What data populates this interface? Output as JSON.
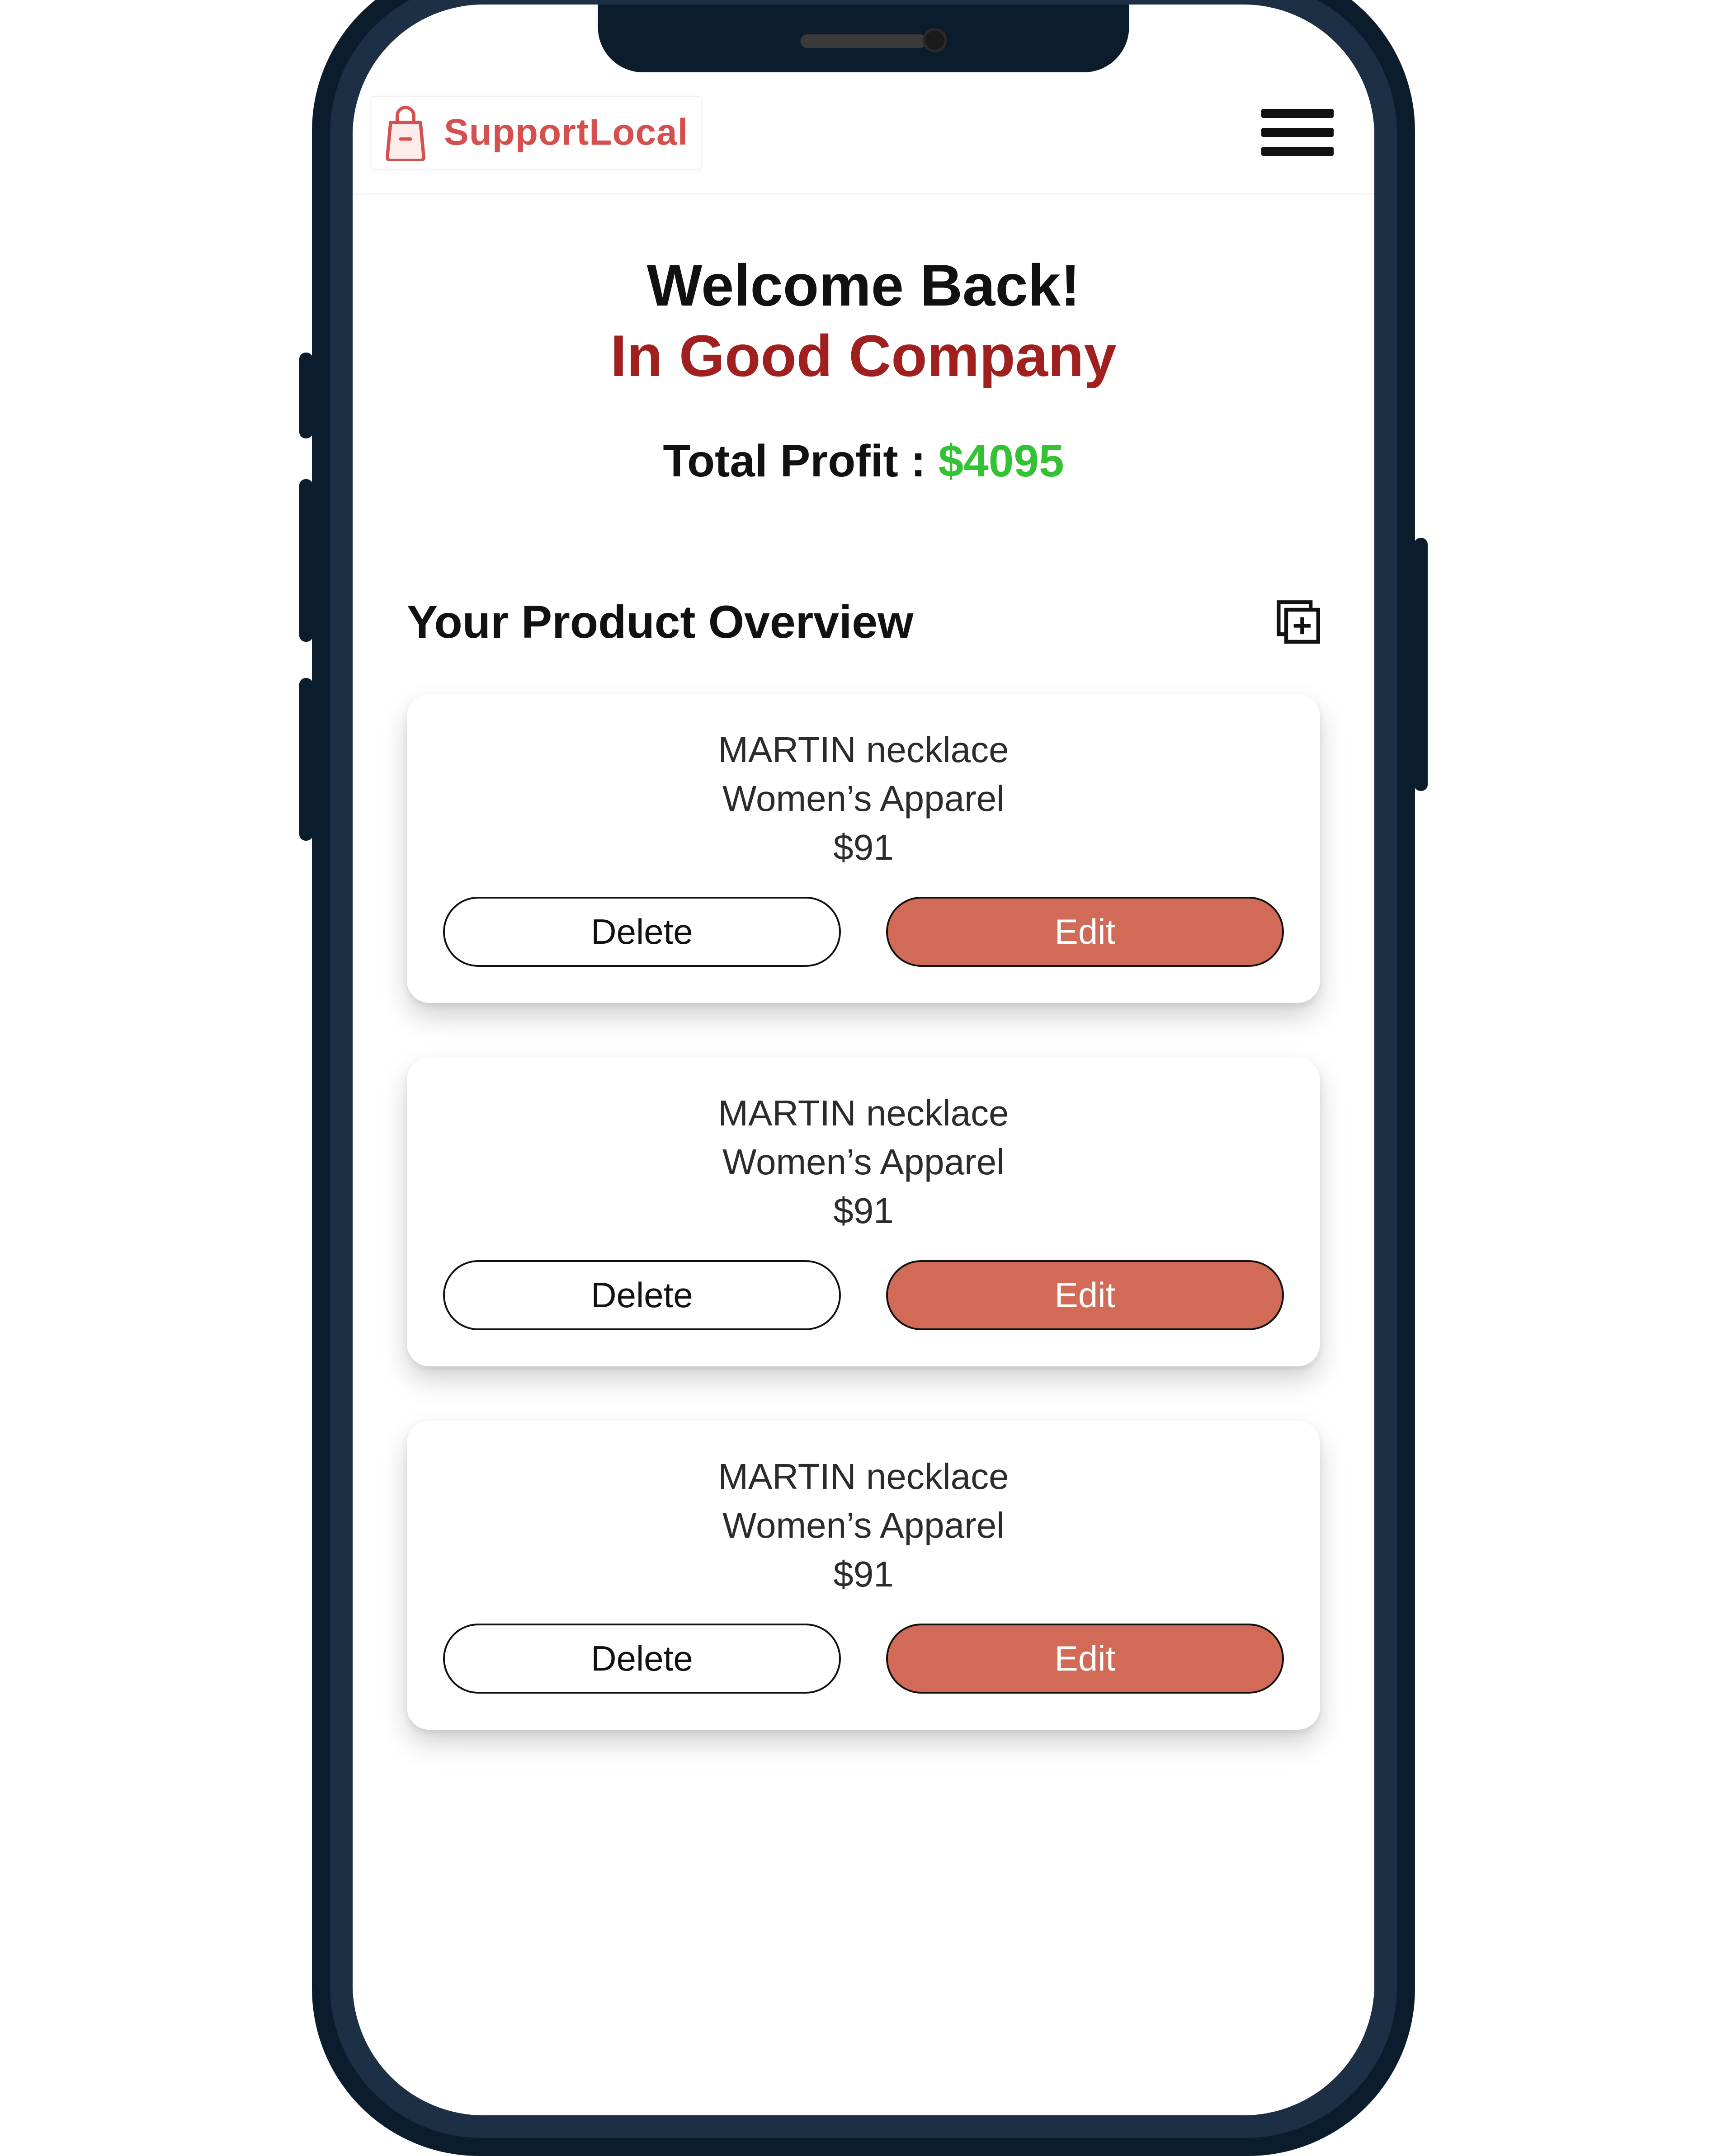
{
  "brand": {
    "name": "SupportLocal"
  },
  "hero": {
    "welcome": "Welcome Back!",
    "company": "In Good Company",
    "profit_label": "Total Profit : ",
    "profit_value": "$4095"
  },
  "overview": {
    "title": "Your Product Overview"
  },
  "buttons": {
    "delete": "Delete",
    "edit": "Edit"
  },
  "products": [
    {
      "name": "MARTIN necklace",
      "category": "Women’s Apparel",
      "price": "$91"
    },
    {
      "name": "MARTIN necklace",
      "category": "Women’s Apparel",
      "price": "$91"
    },
    {
      "name": "MARTIN necklace",
      "category": "Women’s Apparel",
      "price": "$91"
    }
  ],
  "colors": {
    "brand": "#d64f4f",
    "company": "#a02020",
    "profit": "#33c233",
    "edit_button": "#d16a56"
  }
}
